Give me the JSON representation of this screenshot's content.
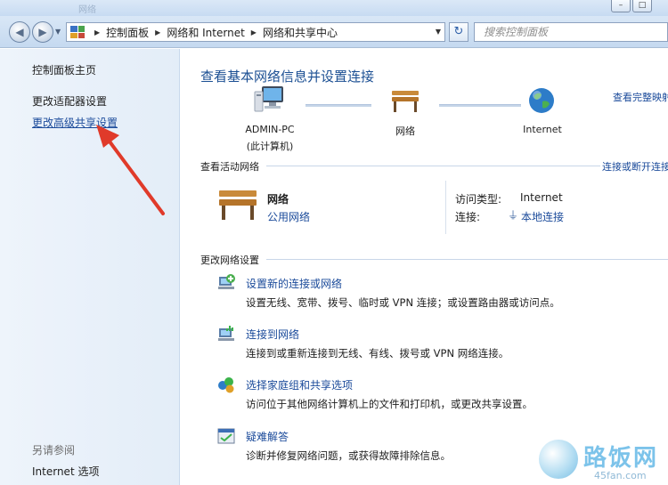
{
  "window": {
    "faint_title": "网络",
    "controls": [
      "–",
      "□"
    ]
  },
  "nav": {
    "address_segments": [
      "控制面板",
      "网络和 Internet",
      "网络和共享中心"
    ],
    "search_placeholder": "搜索控制面板"
  },
  "sidebar": {
    "home": "控制面板主页",
    "adapter_settings": "更改适配器设置",
    "advanced_sharing": "更改高级共享设置",
    "see_also": "另请参阅",
    "internet_options": "Internet 选项"
  },
  "main": {
    "heading": "查看基本网络信息并设置连接",
    "view_full_map": "查看完整映射",
    "map": {
      "pc_name": "ADMIN-PC",
      "pc_sub": "(此计算机)",
      "network": "网络",
      "internet": "Internet"
    },
    "active_section_title": "查看活动网络",
    "connect_disconnect": "连接或断开连接",
    "active_network": {
      "name": "网络",
      "type": "公用网络",
      "access_type_label": "访问类型:",
      "access_type_value": "Internet",
      "connection_label": "连接:",
      "connection_value": "本地连接"
    },
    "change_section_title": "更改网络设置",
    "tasks": [
      {
        "title": "设置新的连接或网络",
        "desc": "设置无线、宽带、拨号、临时或 VPN 连接；或设置路由器或访问点。"
      },
      {
        "title": "连接到网络",
        "desc": "连接到或重新连接到无线、有线、拨号或 VPN 网络连接。"
      },
      {
        "title": "选择家庭组和共享选项",
        "desc": "访问位于其他网络计算机上的文件和打印机，或更改共享设置。"
      },
      {
        "title": "疑难解答",
        "desc": "诊断并修复网络问题，或获得故障排除信息。"
      }
    ]
  },
  "watermark": {
    "cn": "路饭网",
    "url": "45fan.com"
  }
}
